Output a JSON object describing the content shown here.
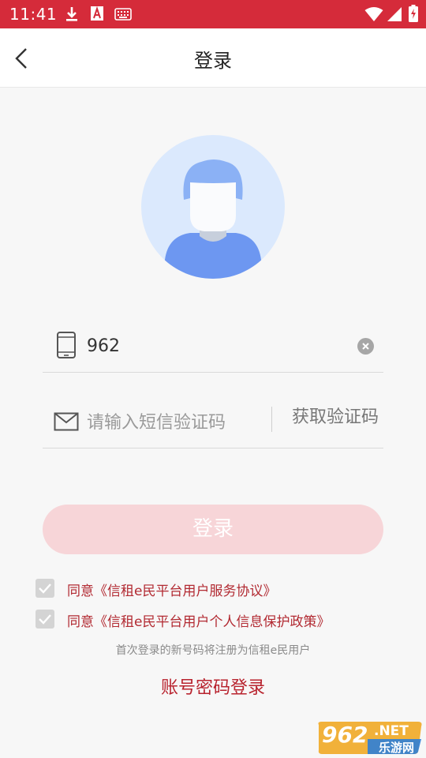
{
  "status_bar": {
    "time": "11:41",
    "background": "#d52b3a"
  },
  "header": {
    "title": "登录"
  },
  "form": {
    "phone_value": "962",
    "code_placeholder": "请输入短信验证码",
    "get_code_label": "获取验证码"
  },
  "login_button": {
    "label": "登录"
  },
  "agreements": [
    {
      "label": "同意《信租e民平台用户服务协议》",
      "checked": true
    },
    {
      "label": "同意《信租e民平台用户个人信息保护政策》",
      "checked": true
    }
  ],
  "hint": "首次登录的新号码将注册为信租e民用户",
  "account_login_label": "账号密码登录",
  "watermark": {
    "brand": "962",
    "suffix": ".NET",
    "caption": "乐游网"
  },
  "colors": {
    "accent": "#b8232e",
    "button_disabled": "#f7d5d8"
  }
}
